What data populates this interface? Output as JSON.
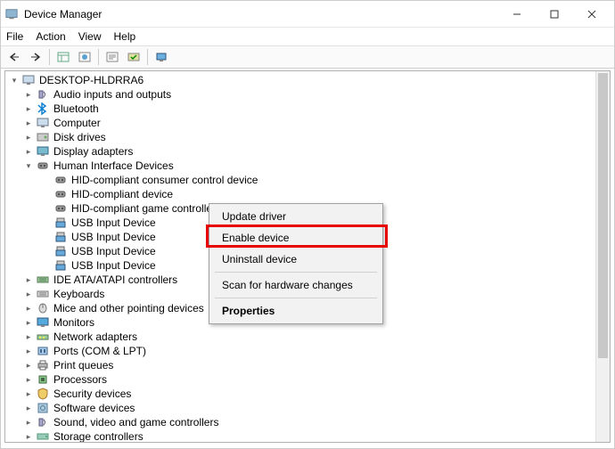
{
  "window": {
    "title": "Device Manager"
  },
  "menu": {
    "file": "File",
    "action": "Action",
    "view": "View",
    "help": "Help"
  },
  "tree": {
    "root": "DESKTOP-HLDRRA6",
    "categories": [
      {
        "label": "Audio inputs and outputs",
        "icon": "speaker",
        "expanded": false
      },
      {
        "label": "Bluetooth",
        "icon": "bluetooth",
        "expanded": false
      },
      {
        "label": "Computer",
        "icon": "computer",
        "expanded": false
      },
      {
        "label": "Disk drives",
        "icon": "disk",
        "expanded": false
      },
      {
        "label": "Display adapters",
        "icon": "display",
        "expanded": false
      },
      {
        "label": "Human Interface Devices",
        "icon": "hid",
        "expanded": true,
        "children": [
          {
            "label": "HID-compliant consumer control device",
            "icon": "hid"
          },
          {
            "label": "HID-compliant device",
            "icon": "hid"
          },
          {
            "label": "HID-compliant game controller",
            "icon": "hid"
          },
          {
            "label": "USB Input Device",
            "icon": "usb"
          },
          {
            "label": "USB Input Device",
            "icon": "usb"
          },
          {
            "label": "USB Input Device",
            "icon": "usb"
          },
          {
            "label": "USB Input Device",
            "icon": "usb"
          }
        ]
      },
      {
        "label": "IDE ATA/ATAPI controllers",
        "icon": "ide",
        "expanded": false
      },
      {
        "label": "Keyboards",
        "icon": "keyboard",
        "expanded": false
      },
      {
        "label": "Mice and other pointing devices",
        "icon": "mouse",
        "expanded": false
      },
      {
        "label": "Monitors",
        "icon": "monitor",
        "expanded": false
      },
      {
        "label": "Network adapters",
        "icon": "network",
        "expanded": false
      },
      {
        "label": "Ports (COM & LPT)",
        "icon": "ports",
        "expanded": false
      },
      {
        "label": "Print queues",
        "icon": "print",
        "expanded": false
      },
      {
        "label": "Processors",
        "icon": "cpu",
        "expanded": false
      },
      {
        "label": "Security devices",
        "icon": "security",
        "expanded": false
      },
      {
        "label": "Software devices",
        "icon": "software",
        "expanded": false
      },
      {
        "label": "Sound, video and game controllers",
        "icon": "sound",
        "expanded": false
      },
      {
        "label": "Storage controllers",
        "icon": "storage",
        "expanded": false
      }
    ]
  },
  "context_menu": {
    "items": [
      {
        "label": "Update driver",
        "bold": false
      },
      {
        "label": "Enable device",
        "bold": false,
        "highlighted": true
      },
      {
        "label": "Uninstall device",
        "bold": false
      },
      {
        "sep": true
      },
      {
        "label": "Scan for hardware changes",
        "bold": false
      },
      {
        "sep": true
      },
      {
        "label": "Properties",
        "bold": true
      }
    ]
  }
}
